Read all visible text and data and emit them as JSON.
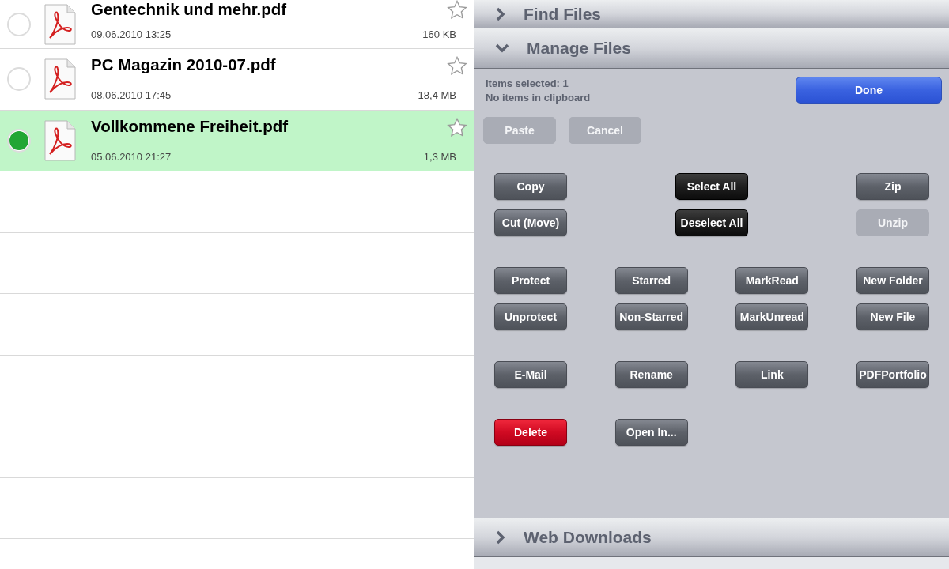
{
  "files": [
    {
      "name": "Gentechnik und mehr.pdf",
      "date": "09.06.2010 13:25",
      "size": "160 KB",
      "selected": false,
      "starred": false
    },
    {
      "name": "PC Magazin 2010-07.pdf",
      "date": "08.06.2010 17:45",
      "size": "18,4 MB",
      "selected": false,
      "starred": false
    },
    {
      "name": "Vollkommene Freiheit.pdf",
      "date": "05.06.2010 21:27",
      "size": "1,3 MB",
      "selected": true,
      "starred": false
    }
  ],
  "sections_top": [
    {
      "title": "Find Files",
      "expanded": false
    },
    {
      "title": "Manage Files",
      "expanded": true
    }
  ],
  "manage": {
    "status_lines": [
      "Items selected: 1",
      "No items in clipboard"
    ],
    "done_button": "Done",
    "clipboard_buttons": [
      {
        "label": "Paste",
        "disabled": true
      },
      {
        "label": "Cancel",
        "disabled": true
      }
    ],
    "groups": [
      {
        "kind": "spread",
        "rows": [
          [
            {
              "label": "Copy",
              "kind": "normal"
            },
            {
              "label": "Select All",
              "kind": "dark"
            },
            {
              "label": "Zip",
              "kind": "normal"
            }
          ],
          [
            {
              "label": "Cut (Move)",
              "kind": "normal"
            },
            {
              "label": "Deselect All",
              "kind": "dark"
            },
            {
              "label": "Unzip",
              "kind": "disabled"
            }
          ]
        ]
      },
      {
        "kind": "grid",
        "rows": [
          [
            {
              "label": "Protect",
              "kind": "normal"
            },
            {
              "label": "Starred",
              "kind": "normal"
            },
            {
              "label": "MarkRead",
              "kind": "normal"
            },
            {
              "label": "New Folder",
              "kind": "normal"
            }
          ],
          [
            {
              "label": "Unprotect",
              "kind": "normal"
            },
            {
              "label": "Non-Starred",
              "kind": "normal"
            },
            {
              "label": "MarkUnread",
              "kind": "normal"
            },
            {
              "label": "New File",
              "kind": "normal"
            }
          ]
        ]
      },
      {
        "kind": "grid",
        "rows": [
          [
            {
              "label": "E-Mail",
              "kind": "normal"
            },
            {
              "label": "Rename",
              "kind": "normal"
            },
            {
              "label": "Link",
              "kind": "normal"
            },
            {
              "label": "PDFPortfolio",
              "kind": "normal"
            }
          ]
        ]
      },
      {
        "kind": "grid",
        "rows": [
          [
            {
              "label": "Delete",
              "kind": "danger"
            },
            {
              "label": "Open In...",
              "kind": "normal"
            }
          ]
        ]
      }
    ]
  },
  "sections_bottom": [
    {
      "title": "Web Downloads",
      "expanded": false
    }
  ]
}
